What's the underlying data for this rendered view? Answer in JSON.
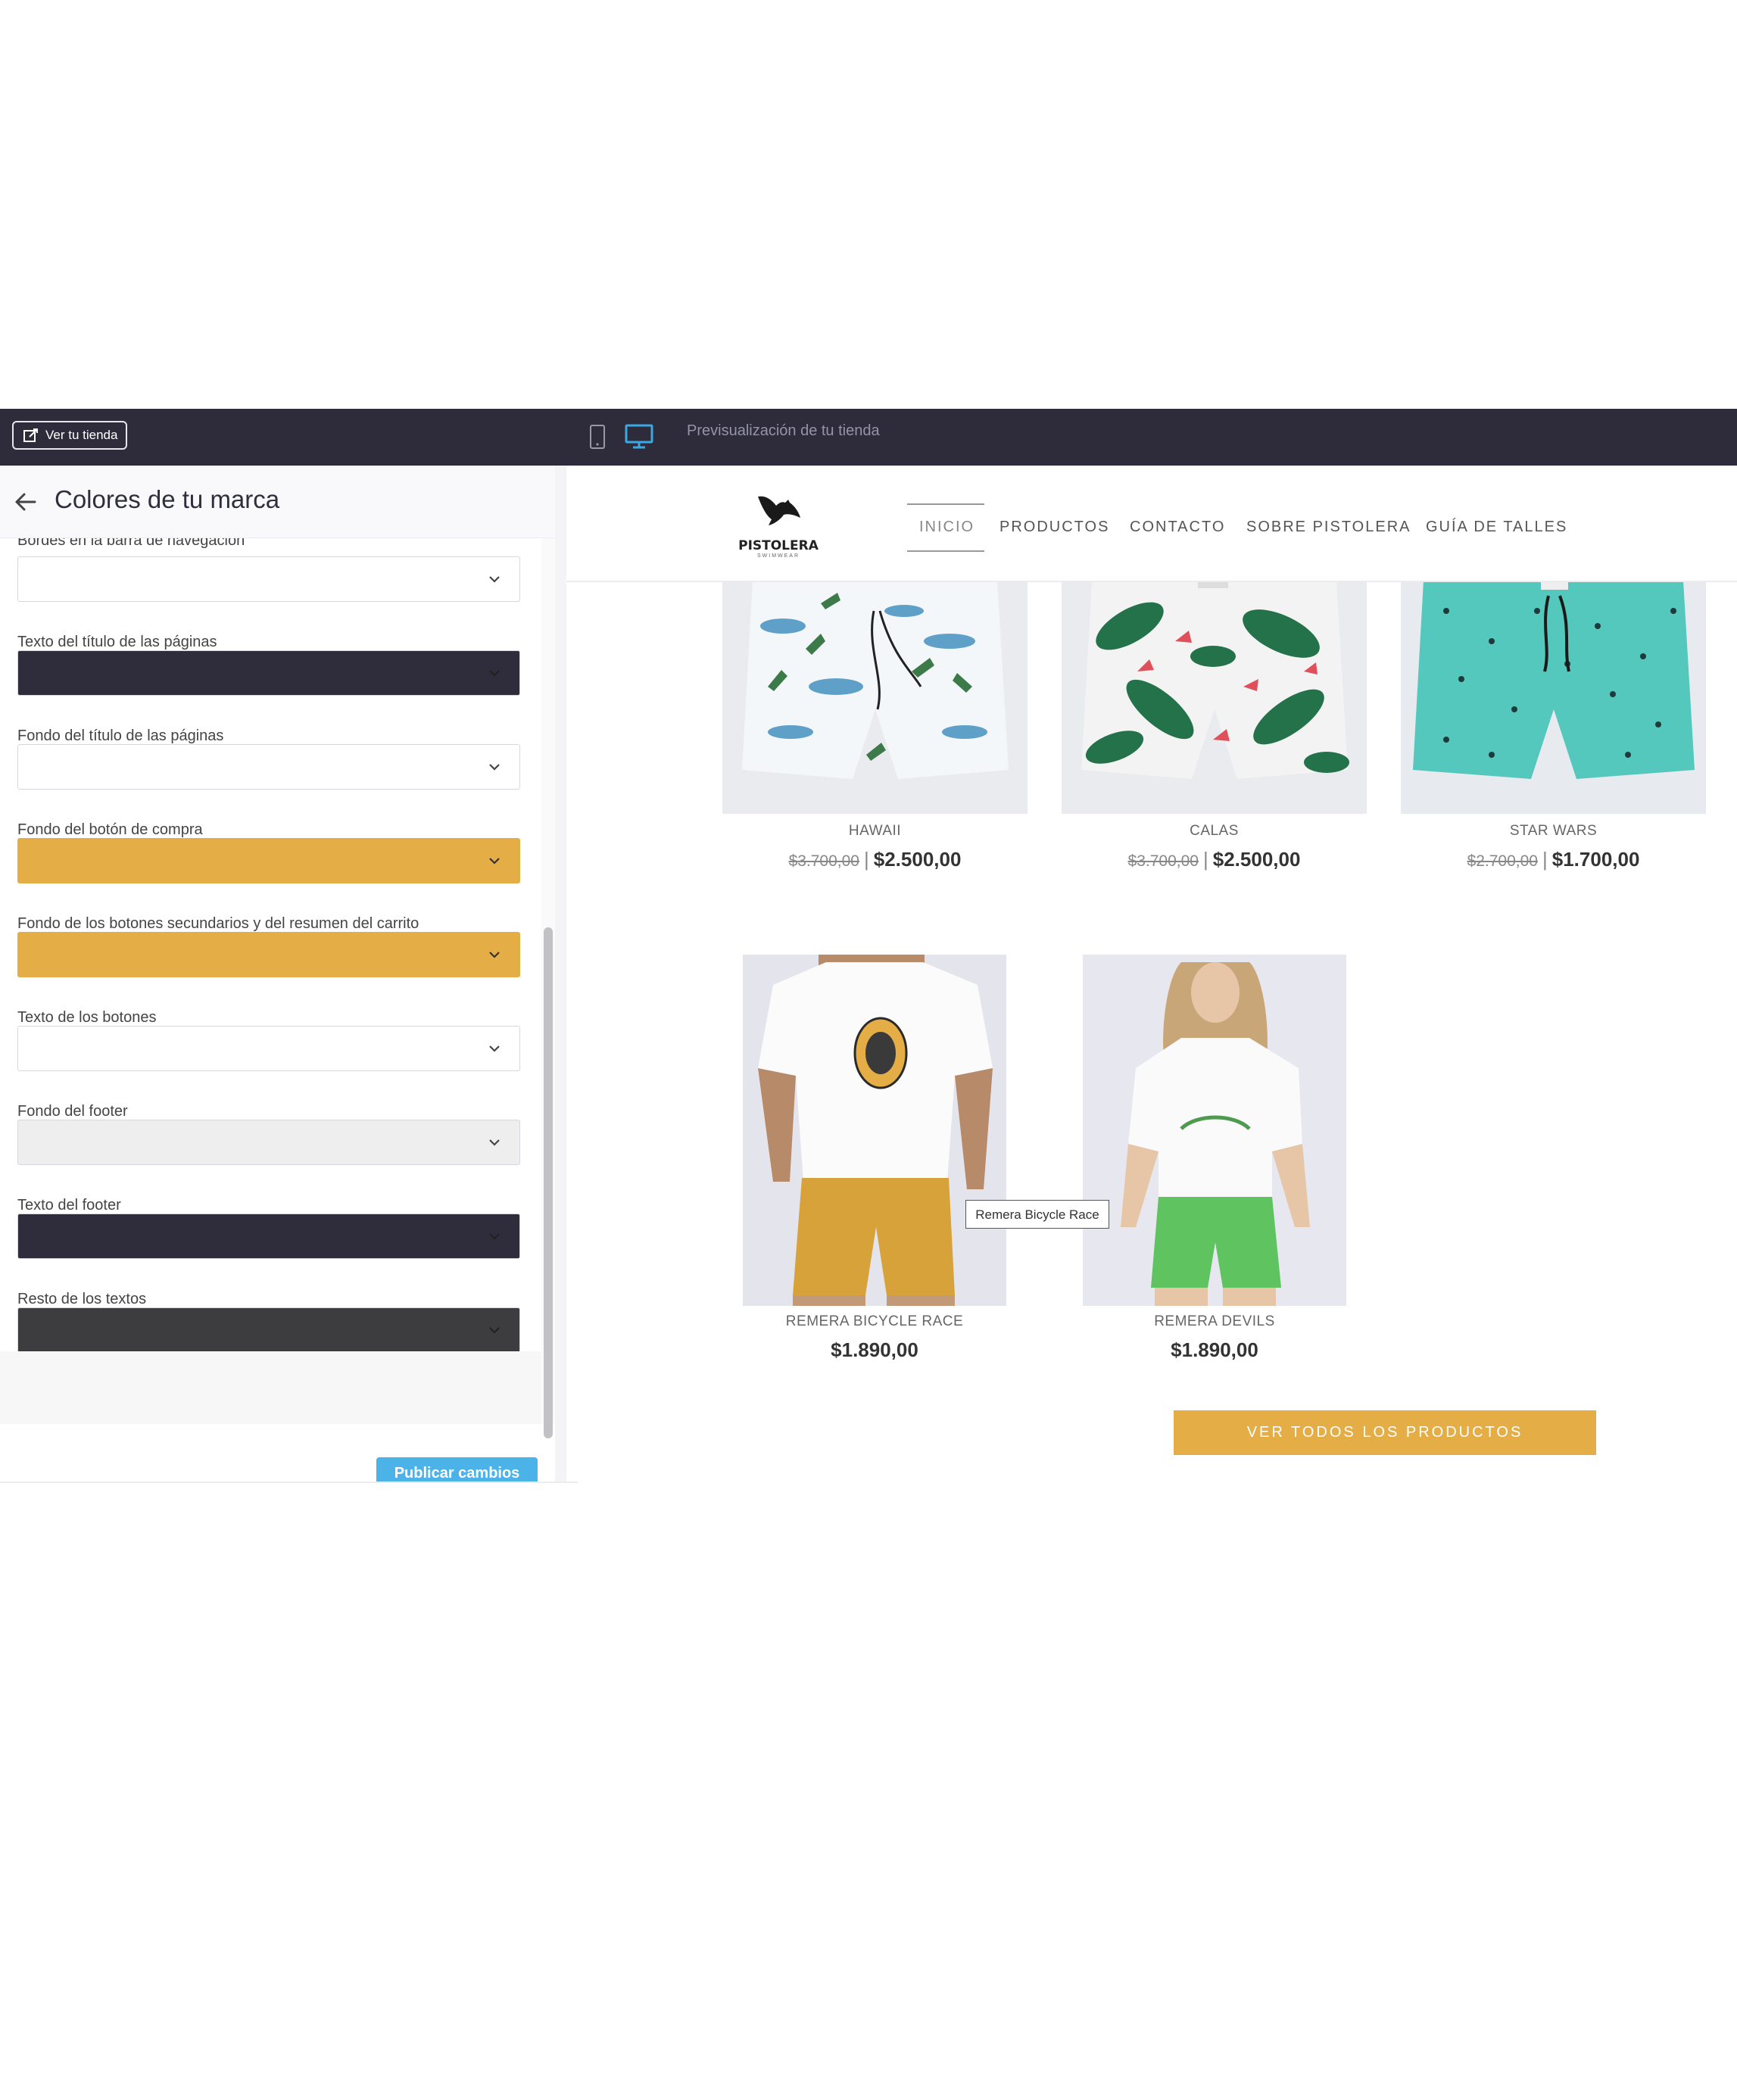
{
  "topbar": {
    "ver_tienda": "Ver tu tienda",
    "preview_label": "Previsualización de tu tienda",
    "device_icons": [
      "mobile-icon",
      "desktop-icon"
    ]
  },
  "panel": {
    "title": "Colores de tu marca",
    "publish_label": "Publicar cambios",
    "fields": [
      {
        "label": "Bordes en la barra de navegación",
        "color": "#ffffff"
      },
      {
        "label": "Texto del título de las páginas",
        "color": "#2f2d3b"
      },
      {
        "label": "Fondo del título de las páginas",
        "color": "#ffffff"
      },
      {
        "label": "Fondo del botón de compra",
        "color": "#e5ad46"
      },
      {
        "label": "Fondo de los botones secundarios y del resumen del carrito",
        "color": "#e5ad46"
      },
      {
        "label": "Texto de los botones",
        "color": "#ffffff"
      },
      {
        "label": "Fondo del footer",
        "color": "#eeeeee"
      },
      {
        "label": "Texto del footer",
        "color": "#2f2d3b"
      },
      {
        "label": "Resto de los textos",
        "color": "#3d3d3f"
      }
    ]
  },
  "store": {
    "logo_text": "PISTOLERA",
    "logo_sub": "SWIMWEAR",
    "nav": [
      "INICIO",
      "PRODUCTOS",
      "CONTACTO",
      "SOBRE PISTOLERA",
      "GUÍA DE TALLES"
    ],
    "products_row1": [
      {
        "name": "HAWAII",
        "old_price": "$3.700,00",
        "price": "$2.500,00"
      },
      {
        "name": "CALAS",
        "old_price": "$3.700,00",
        "price": "$2.500,00"
      },
      {
        "name": "STAR WARS",
        "old_price": "$2.700,00",
        "price": "$1.700,00"
      }
    ],
    "products_row2": [
      {
        "name": "REMERA BICYCLE RACE",
        "price": "$1.890,00"
      },
      {
        "name": "REMERA DEVILS",
        "price": "$1.890,00"
      }
    ],
    "tooltip": "Remera Bicycle Race",
    "cta": "VER TODOS LOS PRODUCTOS"
  },
  "colors": {
    "topbar": "#2e2c3a",
    "accent": "#e5ad46",
    "publish": "#4bb3e8"
  }
}
